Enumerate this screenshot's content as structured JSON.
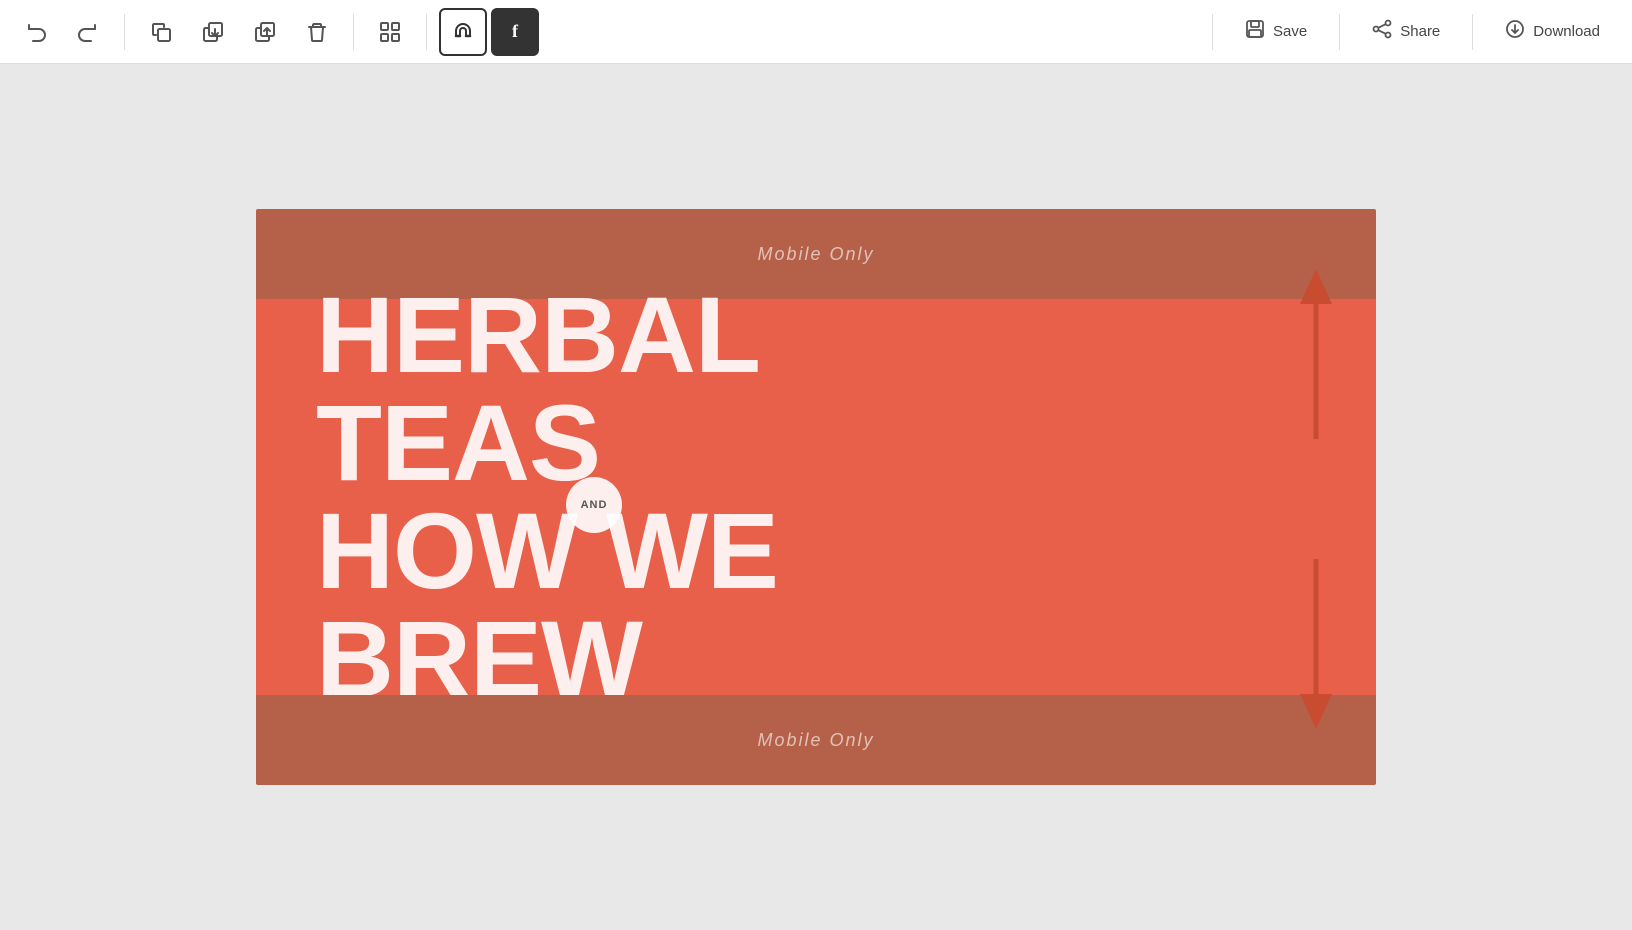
{
  "toolbar": {
    "undo_label": "↺",
    "redo_label": "↻",
    "copy_label": "⧉",
    "layer_down_label": "⬇",
    "layer_up_label": "⬆",
    "delete_label": "🗑",
    "grid_label": "⊞",
    "magnet_label": "⊕",
    "facebook_label": "f",
    "save_label": "Save",
    "share_label": "Share",
    "download_label": "Download"
  },
  "canvas": {
    "mobile_only_top": "Mobile Only",
    "mobile_only_bottom": "Mobile Only",
    "headline_line1": "HERBAL",
    "headline_line2": "TEAS",
    "headline_line3": "HOW WE",
    "headline_line4": "BREW",
    "and_badge": "AND",
    "bg_color": "#e8604a",
    "band_color": "#b5614a",
    "text_color": "rgba(255,255,255,0.88)"
  },
  "colors": {
    "toolbar_bg": "#ffffff",
    "canvas_bg": "#e8e8e8",
    "arrow_color": "#c94b30"
  }
}
